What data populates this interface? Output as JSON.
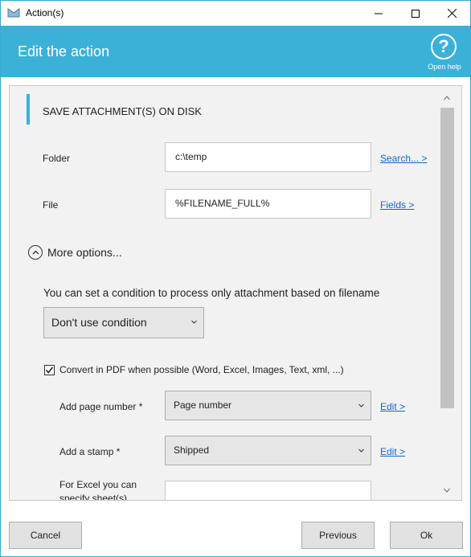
{
  "window": {
    "title": "Action(s)",
    "icon": "envelope-app-icon"
  },
  "header": {
    "title": "Edit the action",
    "help_label": "Open help",
    "help_glyph": "?"
  },
  "section": {
    "title": "SAVE ATTACHMENT(S) ON DISK"
  },
  "folder": {
    "label": "Folder",
    "value": "c:\\temp",
    "link": "Search... >"
  },
  "file": {
    "label": "File",
    "value": "%FILENAME_FULL%",
    "link": "Fields >"
  },
  "more_options": {
    "label": "More options...",
    "icon": "chevron-up-circle-icon"
  },
  "condition": {
    "text": "You can set a condition to process only attachment based on filename",
    "selected": "Don't use condition"
  },
  "convert_pdf": {
    "checked": true,
    "label": "Convert in PDF when possible (Word, Excel, Images, Text, xml, ...)"
  },
  "page_number": {
    "label": "Add page number *",
    "selected": "Page number",
    "link": "Edit >"
  },
  "stamp": {
    "label": "Add a stamp *",
    "selected": "Shipped",
    "link": "Edit >"
  },
  "excel_sheets": {
    "label_line1": "For Excel you can",
    "label_line2": "specify sheet(s)",
    "value": ""
  },
  "buttons": {
    "cancel": "Cancel",
    "previous": "Previous",
    "ok": "Ok"
  },
  "colors": {
    "accent": "#3bb1d8",
    "link": "#1565c0"
  }
}
